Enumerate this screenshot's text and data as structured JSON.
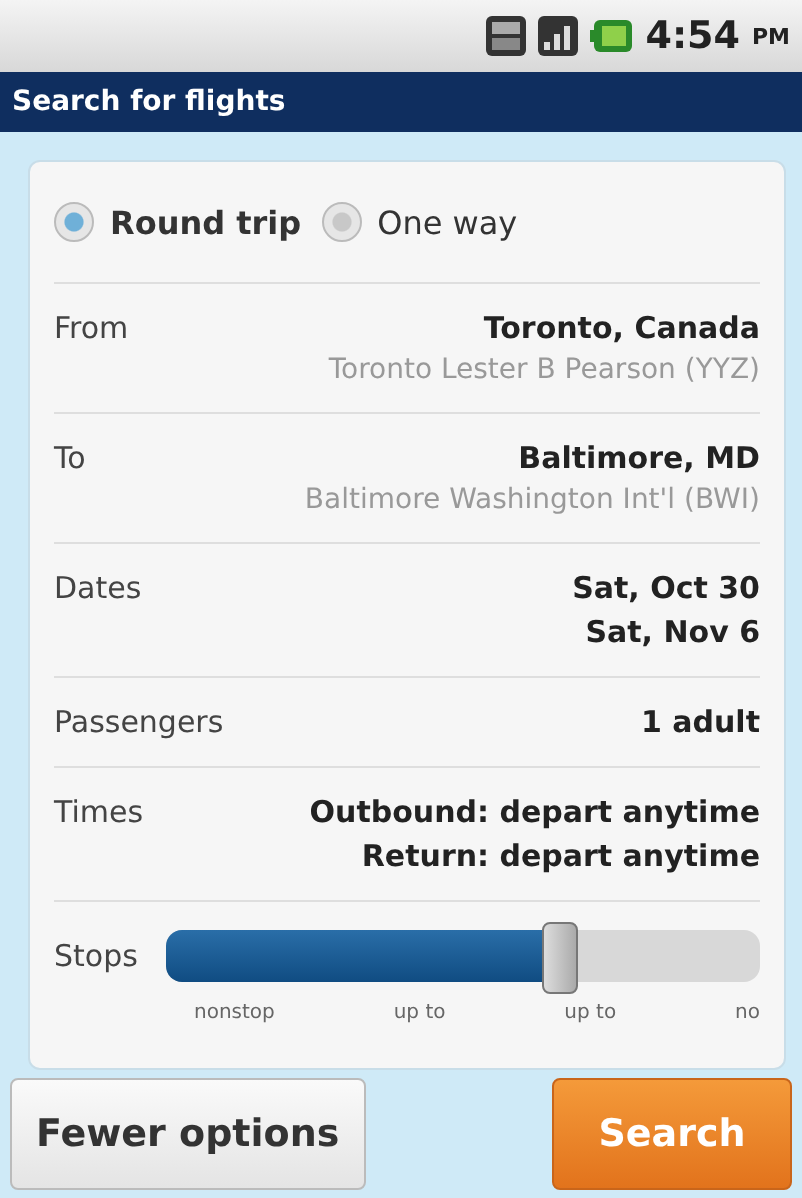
{
  "status_bar": {
    "time": "4:54",
    "ampm": "PM"
  },
  "title": "Search for flights",
  "trip_types": [
    {
      "label": "Round trip",
      "selected": true
    },
    {
      "label": "One way",
      "selected": false
    }
  ],
  "fields": [
    {
      "label": "From",
      "values": [
        "Toronto, Canada"
      ],
      "detail": "Toronto Lester B Pearson (YYZ)"
    },
    {
      "label": "To",
      "values": [
        "Baltimore, MD"
      ],
      "detail": "Baltimore Washington Int'l (BWI)"
    },
    {
      "label": "Dates",
      "values": [
        "Sat, Oct 30",
        "Sat, Nov 6"
      ]
    },
    {
      "label": "Passengers",
      "values": [
        "1 adult"
      ]
    },
    {
      "label": "Times",
      "values": [
        "Outbound: depart anytime",
        "Return: depart anytime"
      ]
    }
  ],
  "stops": {
    "label": "Stops",
    "level": 0.66,
    "ticks": [
      "nonstop",
      "up to",
      "up to",
      "no"
    ]
  },
  "buttons": [
    {
      "label": "Fewer options",
      "kind": "secondary"
    },
    {
      "label": "Search",
      "kind": "primary"
    }
  ]
}
